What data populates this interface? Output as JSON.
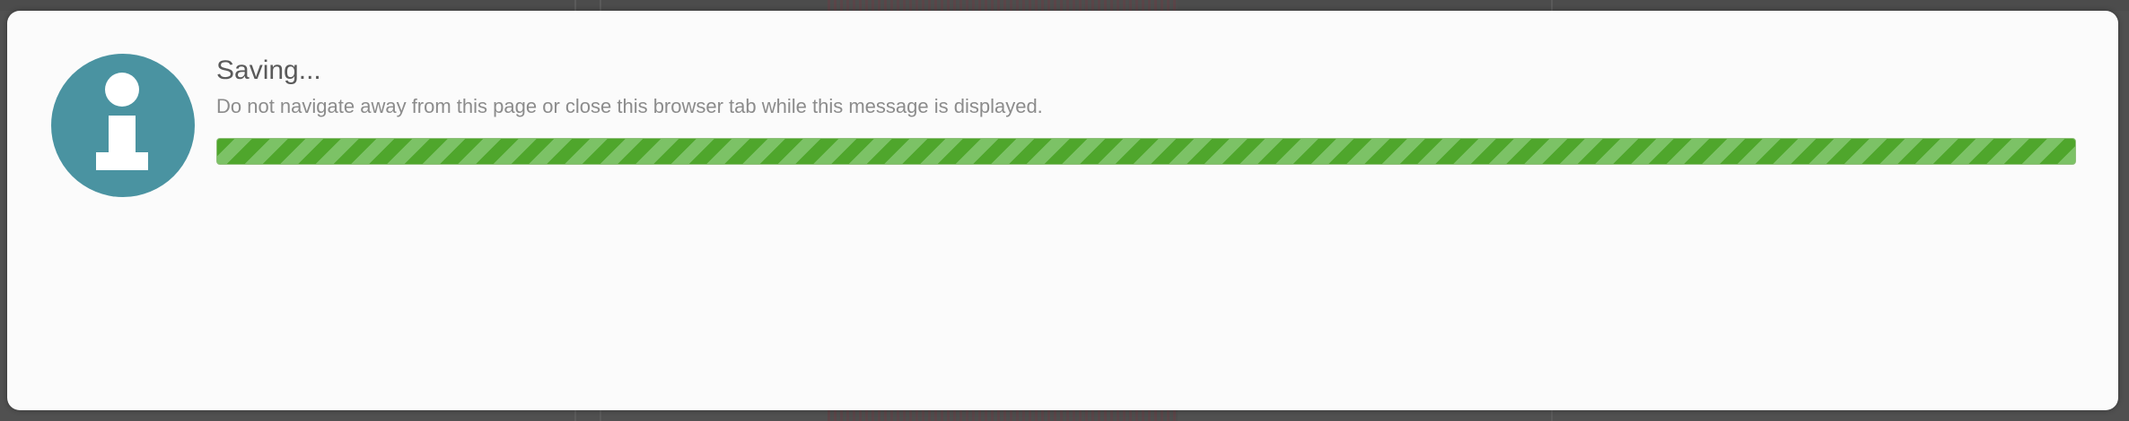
{
  "dialog": {
    "title": "Saving...",
    "message": "Do not navigate away from this page or close this browser tab while this message is displayed.",
    "icon": "info-icon",
    "progress": 1.0
  },
  "colors": {
    "icon_background": "#4a93a1",
    "progress_dark": "#4fa62c",
    "progress_light": "#7cc266",
    "dialog_background": "#fbfbfb",
    "overlay": "#505050"
  }
}
